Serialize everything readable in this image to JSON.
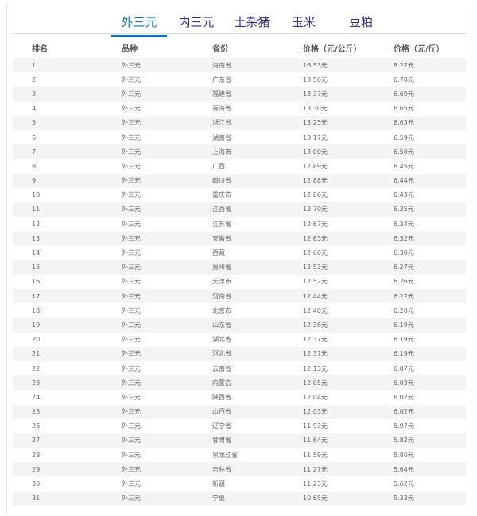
{
  "tabs": [
    {
      "label": "外三元",
      "active": true
    },
    {
      "label": "内三元",
      "active": false
    },
    {
      "label": "土杂猪",
      "active": false
    },
    {
      "label": "玉米",
      "active": false
    },
    {
      "label": "豆粕",
      "active": false
    }
  ],
  "table": {
    "headers": [
      "排名",
      "品种",
      "省份",
      "价格（元/公斤）",
      "价格（元/斤）"
    ],
    "rows": [
      [
        "1",
        "外三元",
        "海南省",
        "16.53元",
        "8.27元"
      ],
      [
        "2",
        "外三元",
        "广东省",
        "13.56元",
        "6.78元"
      ],
      [
        "3",
        "外三元",
        "福建省",
        "13.37元",
        "6.69元"
      ],
      [
        "4",
        "外三元",
        "青海省",
        "13.30元",
        "6.65元"
      ],
      [
        "5",
        "外三元",
        "浙江省",
        "13.25元",
        "6.63元"
      ],
      [
        "6",
        "外三元",
        "湖南省",
        "13.17元",
        "6.59元"
      ],
      [
        "7",
        "外三元",
        "上海市",
        "13.00元",
        "6.50元"
      ],
      [
        "8",
        "外三元",
        "广西",
        "12.89元",
        "6.45元"
      ],
      [
        "9",
        "外三元",
        "四川省",
        "12.88元",
        "6.44元"
      ],
      [
        "10",
        "外三元",
        "重庆市",
        "12.86元",
        "6.43元"
      ],
      [
        "11",
        "外三元",
        "江西省",
        "12.70元",
        "6.35元"
      ],
      [
        "12",
        "外三元",
        "江苏省",
        "12.67元",
        "6.34元"
      ],
      [
        "13",
        "外三元",
        "安徽省",
        "12.63元",
        "6.32元"
      ],
      [
        "14",
        "外三元",
        "西藏",
        "12.60元",
        "6.30元"
      ],
      [
        "15",
        "外三元",
        "贵州省",
        "12.53元",
        "6.27元"
      ],
      [
        "16",
        "外三元",
        "天津市",
        "12.52元",
        "6.26元"
      ],
      [
        "17",
        "外三元",
        "河南省",
        "12.44元",
        "6.22元"
      ],
      [
        "18",
        "外三元",
        "北京市",
        "12.40元",
        "6.20元"
      ],
      [
        "19",
        "外三元",
        "山东省",
        "12.38元",
        "6.19元"
      ],
      [
        "20",
        "外三元",
        "湖北省",
        "12.37元",
        "6.19元"
      ],
      [
        "21",
        "外三元",
        "河北省",
        "12.37元",
        "6.19元"
      ],
      [
        "22",
        "外三元",
        "云南省",
        "12.13元",
        "6.07元"
      ],
      [
        "23",
        "外三元",
        "内蒙古",
        "12.05元",
        "6.03元"
      ],
      [
        "24",
        "外三元",
        "陕西省",
        "12.04元",
        "6.02元"
      ],
      [
        "25",
        "外三元",
        "山西省",
        "12.03元",
        "6.02元"
      ],
      [
        "26",
        "外三元",
        "辽宁省",
        "11.93元",
        "5.97元"
      ],
      [
        "27",
        "外三元",
        "甘肃省",
        "11.64元",
        "5.82元"
      ],
      [
        "28",
        "外三元",
        "黑龙江省",
        "11.59元",
        "5.80元"
      ],
      [
        "29",
        "外三元",
        "吉林省",
        "11.27元",
        "5.64元"
      ],
      [
        "30",
        "外三元",
        "新疆",
        "11.23元",
        "5.62元"
      ],
      [
        "31",
        "外三元",
        "宁夏",
        "10.65元",
        "5.33元"
      ]
    ]
  }
}
